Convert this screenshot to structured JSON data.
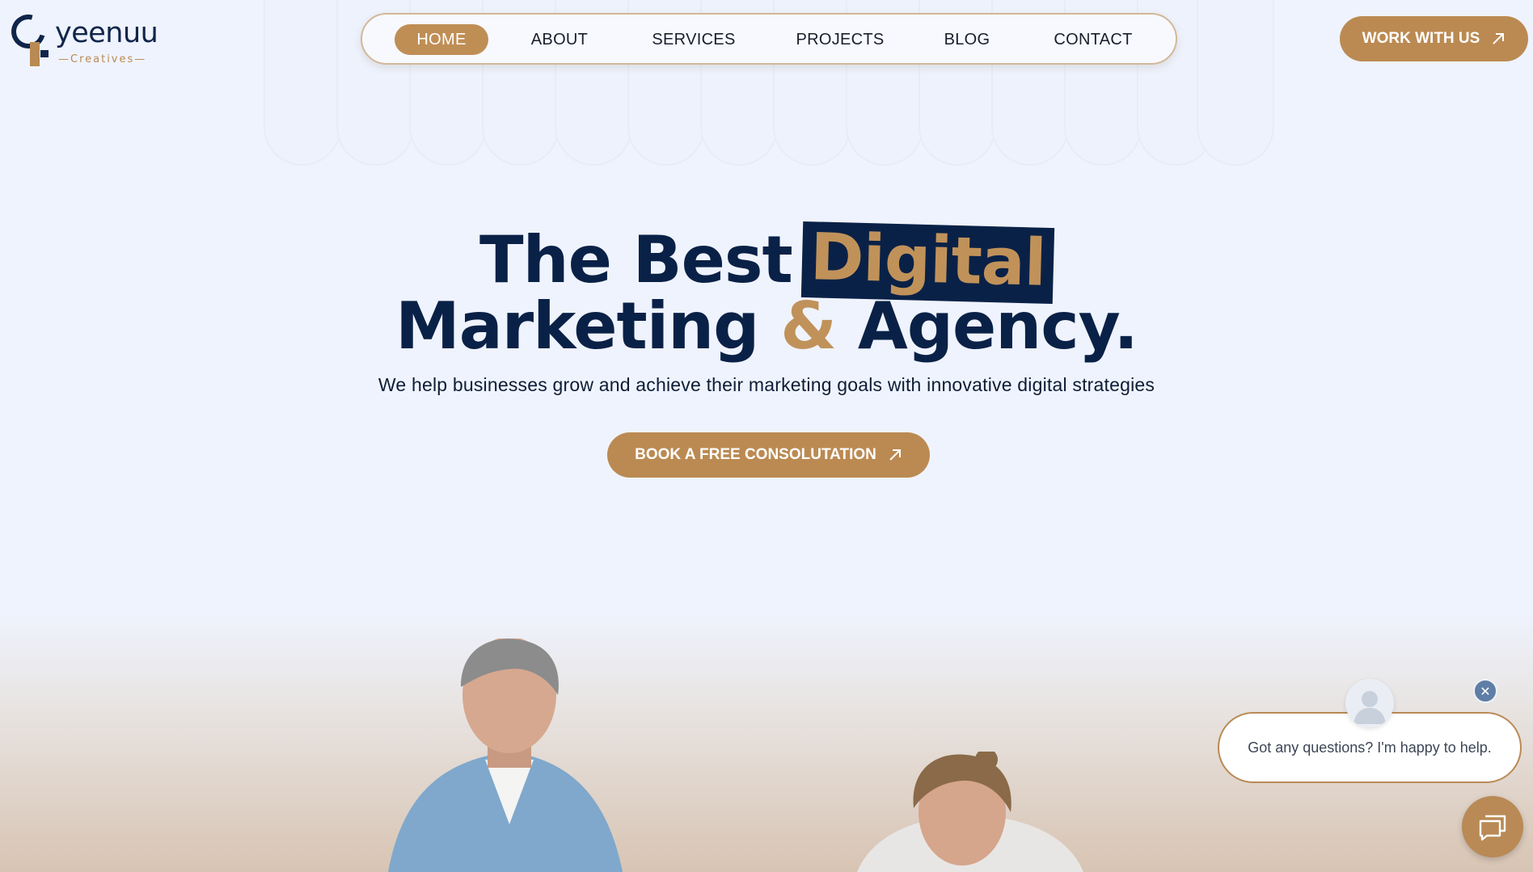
{
  "brand": {
    "logo_word": "yeenuu",
    "logo_sub": "Creatives",
    "primary_color": "#bb8a52",
    "navy_color": "#0a2147"
  },
  "nav": {
    "items": [
      {
        "label": "HOME",
        "active": true
      },
      {
        "label": "ABOUT",
        "active": false
      },
      {
        "label": "SERVICES",
        "active": false
      },
      {
        "label": "PROJECTS",
        "active": false
      },
      {
        "label": "BLOG",
        "active": false
      },
      {
        "label": "CONTACT",
        "active": false
      }
    ]
  },
  "header_cta": {
    "label": "WORK WITH US",
    "icon": "arrow-up-right-icon"
  },
  "hero": {
    "title_part1": "The Best",
    "title_highlight": "Digital",
    "title_line2_a": "Marketing",
    "title_amp": "&",
    "title_line2_b": "Agency.",
    "subtitle": "We help businesses grow and achieve their marketing goals with innovative digital strategies",
    "cta_label": "BOOK A FREE CONSOLUTATION",
    "cta_icon": "arrow-up-right-icon"
  },
  "chat": {
    "message": "Got any questions? I'm happy to help.",
    "close_icon": "close-icon",
    "launcher_icon": "chat-icon",
    "avatar_icon": "user-avatar-icon"
  }
}
